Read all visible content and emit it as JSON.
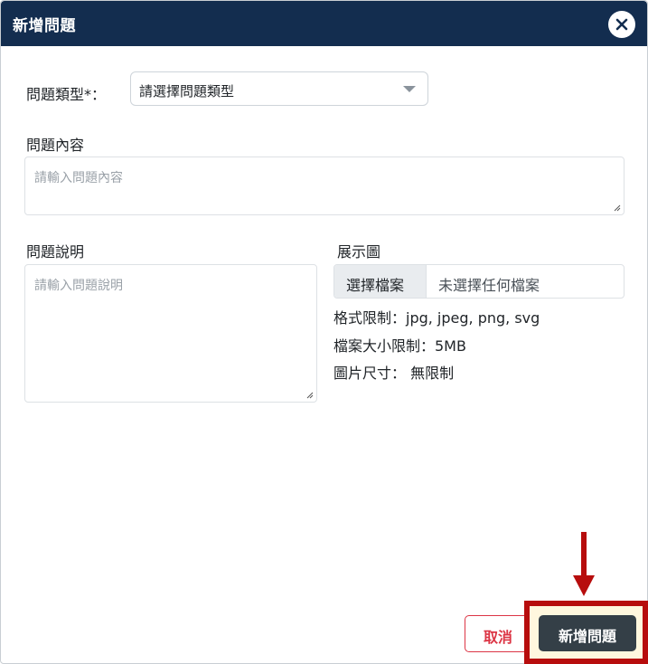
{
  "dialog": {
    "title": "新增問題"
  },
  "form": {
    "type_label": "問題類型*：",
    "type_select_value": "請選擇問題類型",
    "content_label": "問題內容",
    "content_placeholder": "請輸入問題內容",
    "description_label": "問題說明",
    "description_placeholder": "請輸入問題說明",
    "image_label": "展示圖",
    "file_button_label": "選擇檔案",
    "file_status": "未選擇任何檔案",
    "format_limit": "格式限制：jpg, jpeg, png, svg",
    "size_limit": "檔案大小限制：5MB",
    "dimension_limit": "圖片尺寸： 無限制"
  },
  "footer": {
    "cancel_label": "取消",
    "submit_label": "新增問題"
  },
  "icons": {
    "close": "close-icon",
    "caret": "chevron-down-icon",
    "annotation": "arrow-down-icon"
  },
  "colors": {
    "header_bg": "#132d4f",
    "cancel": "#dc3545",
    "submit_bg": "#343f47",
    "highlight_border": "#b70d0d"
  }
}
